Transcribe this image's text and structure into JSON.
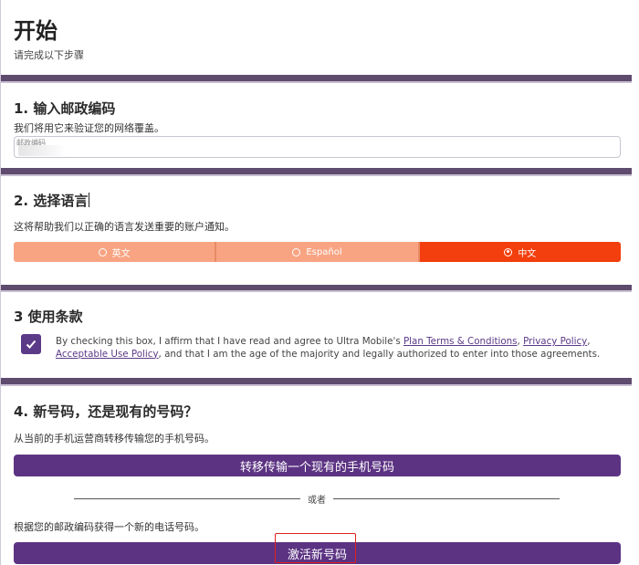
{
  "header": {
    "title": "开始",
    "subtitle": "请完成以下步骤"
  },
  "step1": {
    "title": "1. 输入邮政编码",
    "description": "我们将用它来验证您的网络覆盖。",
    "zip_placeholder": "邮政编码",
    "zip_value": ""
  },
  "step2": {
    "title": "2. 选择语言",
    "description": "这将帮助我们以正确的语言发送重要的账户通知。",
    "options": [
      {
        "label": "英文",
        "selected": false
      },
      {
        "label": "Español",
        "selected": false
      },
      {
        "label": "中文",
        "selected": true
      }
    ]
  },
  "step3": {
    "title": "3 使用条款",
    "checked": true,
    "text_1": "By checking this box, I affirm that I have read and agree to Ultra Mobile's ",
    "link_plan_terms": "Plan Terms & Conditions",
    "sep_1": ", ",
    "link_privacy": "Privacy Policy",
    "sep_2": ", ",
    "link_acceptable_use": "Acceptable Use Policy",
    "text_2": ", and that I am the age of the majority and legally authorized to enter into those agreements."
  },
  "step4": {
    "title": "4. 新号码，还是现有的号码？",
    "transfer_description": "从当前的手机运营商转移传输您的手机号码。",
    "transfer_button": "转移传输一个现有的手机号码",
    "or_label": "或者",
    "new_description": "根据您的邮政编码获得一个新的电话号码。",
    "new_button": "激活新号码"
  },
  "colors": {
    "primary_purple": "#5c3383",
    "divider": "#5f4b6e",
    "lang_inactive": "#f8a483",
    "lang_active": "#f33f0d",
    "highlight_red": "#e0201b"
  }
}
